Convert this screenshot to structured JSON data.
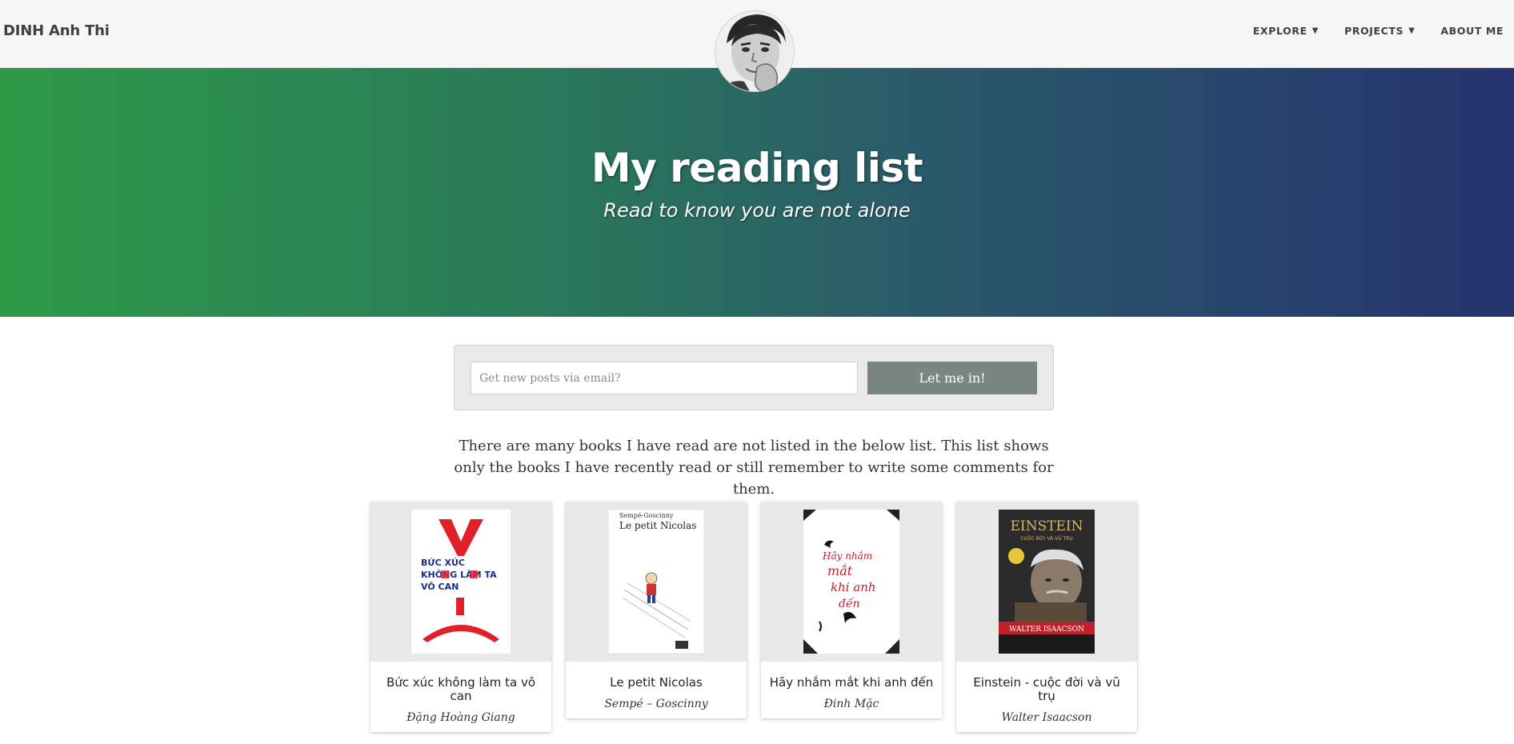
{
  "site": {
    "brand": "DINH Anh Thi"
  },
  "nav": {
    "items": [
      {
        "label": "EXPLORE",
        "caret": "▼"
      },
      {
        "label": "PROJECTS",
        "caret": "▼"
      },
      {
        "label": "ABOUT ME"
      }
    ]
  },
  "hero": {
    "title": "My reading list",
    "subtitle": "Read to know you are not alone"
  },
  "subscribe": {
    "placeholder": "Get new posts via email?",
    "button_label": "Let me in!"
  },
  "intro": "There are many books I have read are not listed in the below list. This list shows only the books I have recently read or still remember to write some comments for them.",
  "books": [
    {
      "title": "Bức xúc không làm ta vô can",
      "author": "Đặng Hoàng Giang",
      "cover_text": [
        "BỨC XÚC",
        "KHÔNG LÀM TA",
        "VÔ CAN"
      ]
    },
    {
      "title": "Le petit Nicolas",
      "author": "Sempé – Goscinny",
      "cover_text": [
        "Sempé-Goscinny",
        "Le petit Nicolas"
      ]
    },
    {
      "title": "Hãy nhắm mắt khi anh đến",
      "author": "Đinh Mặc",
      "cover_text": [
        "Hãy nhắm",
        "mắt",
        "khi anh",
        "đến"
      ]
    },
    {
      "title": "Einstein - cuộc đời và vũ trụ",
      "author": "Walter Isaacson",
      "cover_text": [
        "EINSTEIN",
        "CUỘC ĐỜI VÀ VŨ TRỤ",
        "WALTER ISAACSON"
      ]
    }
  ],
  "colors": {
    "hero_start": "#2e9a48",
    "hero_end": "#25336f",
    "button": "#7a8585"
  }
}
